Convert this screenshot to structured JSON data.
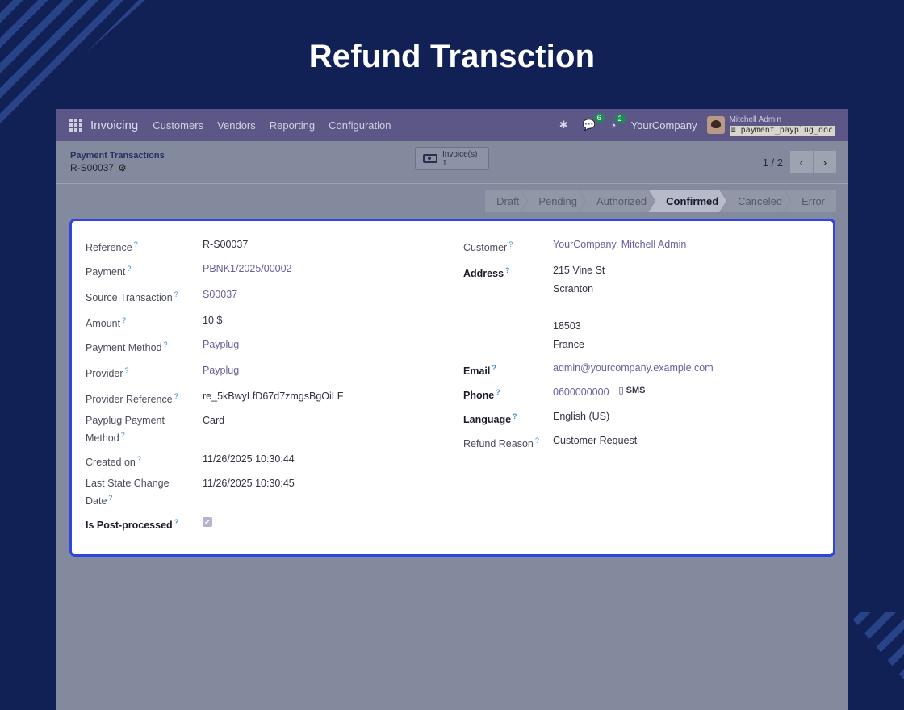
{
  "page_title": "Refund Transction",
  "navbar": {
    "app_name": "Invoicing",
    "menu": [
      "Customers",
      "Vendors",
      "Reporting",
      "Configuration"
    ],
    "messages_count": "6",
    "activities_count": "2",
    "company": "YourCompany",
    "user_name": "Mitchell Admin",
    "database": "payment_payplug_doc"
  },
  "breadcrumb": {
    "parent": "Payment Transactions",
    "current": "R-S00037"
  },
  "smart_button": {
    "label": "Invoice(s)",
    "count": "1"
  },
  "pager": {
    "value": "1 / 2"
  },
  "statuses": [
    {
      "label": "Draft",
      "active": false
    },
    {
      "label": "Pending",
      "active": false
    },
    {
      "label": "Authorized",
      "active": false
    },
    {
      "label": "Confirmed",
      "active": true
    },
    {
      "label": "Canceled",
      "active": false
    },
    {
      "label": "Error",
      "active": false
    }
  ],
  "form": {
    "reference": {
      "label": "Reference",
      "value": "R-S00037"
    },
    "payment": {
      "label": "Payment",
      "value": "PBNK1/2025/00002"
    },
    "source_transaction": {
      "label": "Source Transaction",
      "value": "S00037"
    },
    "amount": {
      "label": "Amount",
      "value": "10 $"
    },
    "payment_method": {
      "label": "Payment Method",
      "value": "Payplug"
    },
    "provider": {
      "label": "Provider",
      "value": "Payplug"
    },
    "provider_reference": {
      "label": "Provider Reference",
      "value": "re_5kBwyLfD67d7zmgsBgOiLF"
    },
    "payplug_payment_method": {
      "label_line1": "Payplug Payment",
      "label_line2": "Method",
      "value": "Card"
    },
    "created_on": {
      "label": "Created on",
      "value": "11/26/2025 10:30:44"
    },
    "last_state_change": {
      "label_line1": "Last State Change",
      "label_line2": "Date",
      "value": "11/26/2025 10:30:45"
    },
    "is_post_processed": {
      "label": "Is Post-processed",
      "checked": true
    },
    "customer": {
      "label": "Customer",
      "value": "YourCompany, Mitchell Admin"
    },
    "address": {
      "label": "Address",
      "street": "215 Vine St",
      "city": "Scranton",
      "zip": "18503",
      "country": "France"
    },
    "email": {
      "label": "Email",
      "value": "admin@yourcompany.example.com"
    },
    "phone": {
      "label": "Phone",
      "value": "0600000000",
      "sms": "SMS"
    },
    "language": {
      "label": "Language",
      "value": "English (US)"
    },
    "refund_reason": {
      "label": "Refund Reason",
      "value": "Customer Request"
    }
  },
  "colors": {
    "background": "#112055",
    "navbar": "#5c5787",
    "sheet_border": "#2f45e0",
    "link": "#6a5e9e"
  }
}
